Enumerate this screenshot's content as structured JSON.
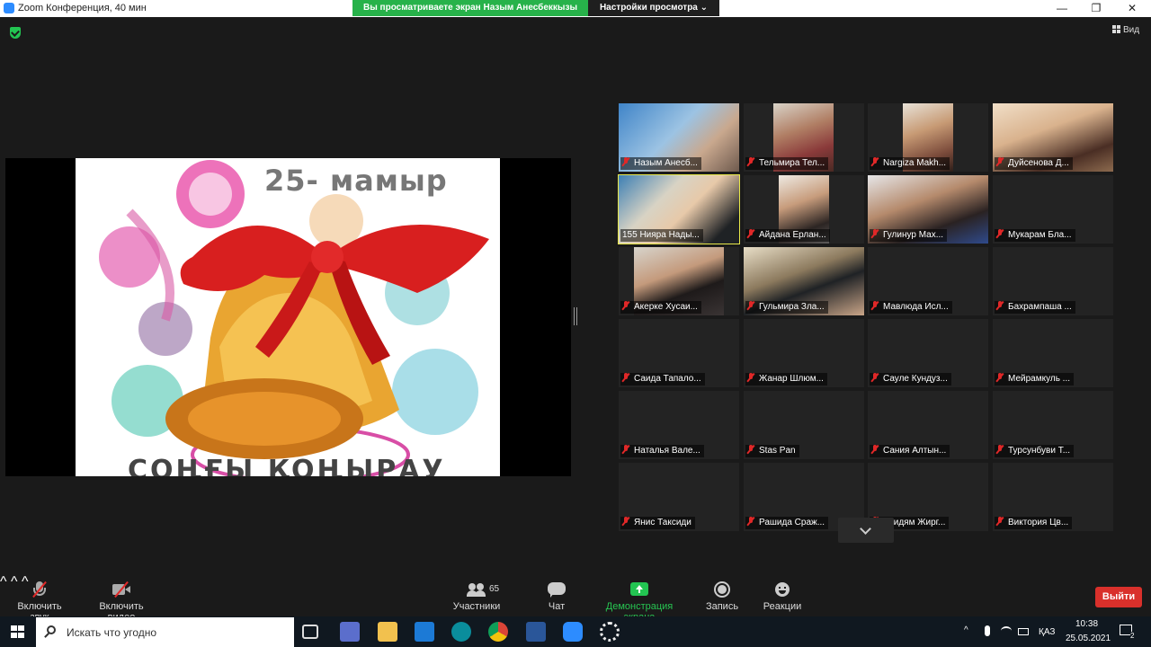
{
  "window": {
    "title": "Zoom Конференция, 40 мин",
    "share_banner": "Вы просматриваете экран Назым Анесбеккызы",
    "view_options": "Настройки просмотра ⌄",
    "controls": [
      "—",
      "❐",
      "✕"
    ]
  },
  "meeting": {
    "view_label": "Вид",
    "slide": {
      "caption_top": "25- мамыр",
      "caption_bottom": "СОҢҒЫ ҚОҢЫРАУ"
    }
  },
  "participants": [
    {
      "name": "Назым Анесб...",
      "video": true
    },
    {
      "name": "Тельмира Тел...",
      "video": true
    },
    {
      "name": "Nargiza Makh...",
      "video": true
    },
    {
      "name": "Дуйсенова Д...",
      "video": true
    },
    {
      "name": "155 Нияра Нады...",
      "video": true,
      "active": true
    },
    {
      "name": "Айдана Ерлан...",
      "video": true
    },
    {
      "name": "Гулинур Мах...",
      "video": true
    },
    {
      "name": "Мукарам Бла...",
      "video": false
    },
    {
      "name": "Акерке Хусаи...",
      "video": true
    },
    {
      "name": "Гульмира Зла...",
      "video": true
    },
    {
      "name": "Мавлюда Исл...",
      "video": false
    },
    {
      "name": "Бахрампаша ...",
      "video": false
    },
    {
      "name": "Саида Тапало...",
      "video": false
    },
    {
      "name": "Жанар Шлюм...",
      "video": false
    },
    {
      "name": "Сауле Кундуз...",
      "video": false
    },
    {
      "name": "Мейрамкуль ...",
      "video": false
    },
    {
      "name": "Наталья Вале...",
      "video": false
    },
    {
      "name": "Stas Pan",
      "video": false
    },
    {
      "name": "Сания Алтын...",
      "video": false
    },
    {
      "name": "Турсунбуви Т...",
      "video": false
    },
    {
      "name": "Янис Таксиди",
      "video": false
    },
    {
      "name": "Рашида Сраж...",
      "video": false
    },
    {
      "name": "умидям Жирг...",
      "video": false
    },
    {
      "name": "Виктория Цв...",
      "video": false
    }
  ],
  "toolbar": {
    "unmute": "Включить звук",
    "start_video": "Включить видео",
    "participants": "Участники",
    "participants_count": "65",
    "chat": "Чат",
    "share_screen": "Демонстрация экрана",
    "record": "Запись",
    "reactions": "Реакции",
    "leave": "Выйти"
  },
  "taskbar": {
    "search_placeholder": "Искать что угодно",
    "language": "ҚАЗ",
    "time": "10:38",
    "date": "25.05.2021",
    "notification_count": "2"
  },
  "colors": {
    "share_banner": "#27b24a",
    "leave": "#d9302b",
    "muted_mic": "#e02828",
    "active_speaker": "#e8e84a"
  }
}
